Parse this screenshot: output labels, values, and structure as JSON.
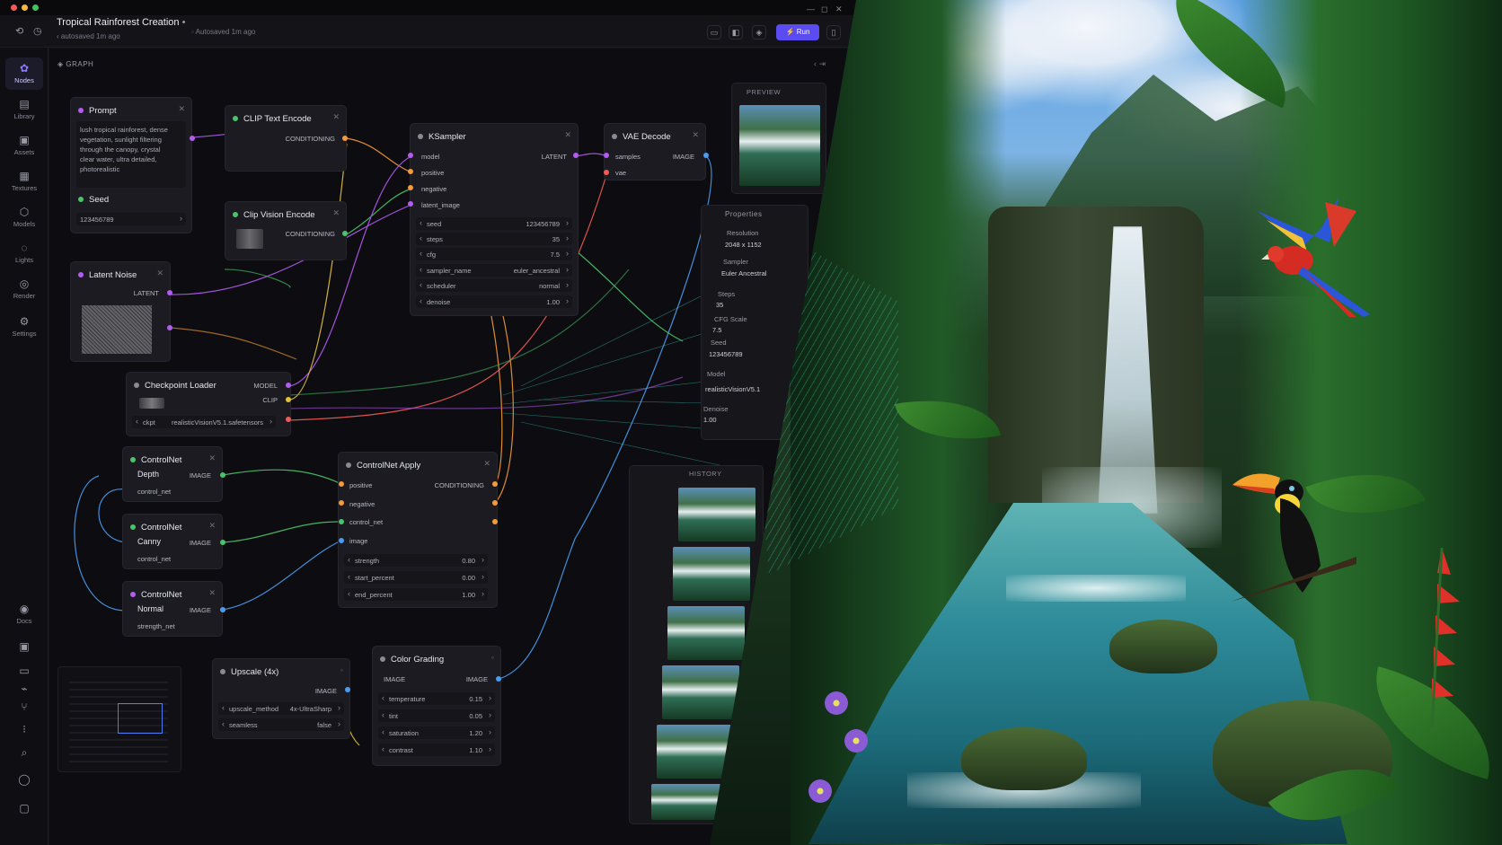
{
  "window": {
    "title": "Tropical Rainforest Creation",
    "title_mark": "•",
    "subtitle": "‹ autosaved 1m ago",
    "autosave_status": "Autosaved 1m ago"
  },
  "header": {
    "run_label": "Run",
    "run_icon": "⚡"
  },
  "sidebar": {
    "items": [
      {
        "label": "Nodes",
        "icon": "nodes-icon",
        "glyph": "✿"
      },
      {
        "label": "Library",
        "icon": "library-icon",
        "glyph": "▤"
      },
      {
        "label": "Assets",
        "icon": "assets-icon",
        "glyph": "▣"
      },
      {
        "label": "Textures",
        "icon": "textures-icon",
        "glyph": "▦"
      },
      {
        "label": "Models",
        "icon": "models-icon",
        "glyph": "⬡"
      },
      {
        "label": "Lights",
        "icon": "lights-icon",
        "glyph": "◌"
      },
      {
        "label": "Render",
        "icon": "render-icon",
        "glyph": "◎"
      },
      {
        "label": "Settings",
        "icon": "settings-icon",
        "glyph": "⚙"
      },
      {
        "label": "Docs",
        "icon": "docs-icon",
        "glyph": "◉"
      }
    ]
  },
  "canvas": {
    "tab": "GRAPH"
  },
  "nodes": {
    "prompt": {
      "title": "Prompt",
      "text": "lush tropical rainforest, dense vegetation, sunlight filtering through the canopy, crystal clear water, ultra detailed, photorealistic"
    },
    "seed": {
      "title": "Seed",
      "value": "123456789"
    },
    "latent_noise": {
      "title": "Latent Noise",
      "out": "LATENT"
    },
    "clip_text": {
      "title": "CLIP Text Encode",
      "out": "CONDITIONING"
    },
    "clip_vision": {
      "title": "Clip Vision Encode",
      "out": "CONDITIONING"
    },
    "ksampler": {
      "title": "KSampler",
      "inputs": [
        "model",
        "positive",
        "negative",
        "latent_image"
      ],
      "out": "LATENT",
      "params": [
        {
          "label": "seed",
          "value": "123456789"
        },
        {
          "label": "steps",
          "value": "35"
        },
        {
          "label": "cfg",
          "value": "7.5"
        },
        {
          "label": "sampler_name",
          "value": "euler_ancestral"
        },
        {
          "label": "scheduler",
          "value": "normal"
        },
        {
          "label": "denoise",
          "value": "1.00"
        }
      ]
    },
    "vae_decode": {
      "title": "VAE Decode",
      "inputs": [
        "samples",
        "vae"
      ],
      "out": "IMAGE"
    },
    "checkpoint": {
      "title": "Checkpoint Loader",
      "out_model": "MODEL",
      "out_clip": "CLIP",
      "param_label": "ckpt",
      "param_value": "realisticVisionV5.1.safetensors"
    },
    "cn_depth": {
      "title": "ControlNet",
      "subtitle": "Depth",
      "out": "IMAGE",
      "port": "control_net"
    },
    "cn_canny": {
      "title": "ControlNet",
      "subtitle": "Canny",
      "out": "IMAGE",
      "port": "control_net"
    },
    "cn_normal": {
      "title": "ControlNet",
      "subtitle": "Normal",
      "out": "IMAGE",
      "port": "strength_net"
    },
    "cn_apply": {
      "title": "ControlNet Apply",
      "inputs": [
        "positive",
        "negative",
        "control_net",
        "image"
      ],
      "out": "CONDITIONING",
      "params": [
        {
          "label": "strength",
          "value": "0.80"
        },
        {
          "label": "start_percent",
          "value": "0.00"
        },
        {
          "label": "end_percent",
          "value": "1.00"
        }
      ]
    },
    "upscale": {
      "title": "Upscale (4x)",
      "out": "IMAGE",
      "params": [
        {
          "label": "upscale_method",
          "value": "4x-UltraSharp"
        },
        {
          "label": "seamless",
          "value": "false"
        }
      ]
    },
    "color_grading": {
      "title": "Color Grading",
      "in": "IMAGE",
      "out": "IMAGE",
      "params": [
        {
          "label": "temperature",
          "value": "0.15"
        },
        {
          "label": "tint",
          "value": "0.05"
        },
        {
          "label": "saturation",
          "value": "1.20"
        },
        {
          "label": "contrast",
          "value": "1.10"
        }
      ]
    }
  },
  "preview": {
    "title": "PREVIEW"
  },
  "properties": {
    "title": "Properties",
    "rows": [
      {
        "label": "Resolution",
        "value": "2048 x 1152"
      },
      {
        "label": "Sampler",
        "value": "Euler Ancestral"
      },
      {
        "label": "Steps",
        "value": "35"
      },
      {
        "label": "CFG Scale",
        "value": "7.5"
      },
      {
        "label": "Seed",
        "value": "123456789"
      },
      {
        "label": "Model",
        "value": "realisticVisionV5.1"
      },
      {
        "label": "Denoise",
        "value": "1.00"
      }
    ]
  },
  "history": {
    "title": "HISTORY"
  },
  "colors": {
    "accent": "#5a4cf0",
    "purple_port": "#b45cf2",
    "orange_port": "#f39a3a",
    "green_port": "#49c46a",
    "blue_port": "#4a9cf0"
  }
}
